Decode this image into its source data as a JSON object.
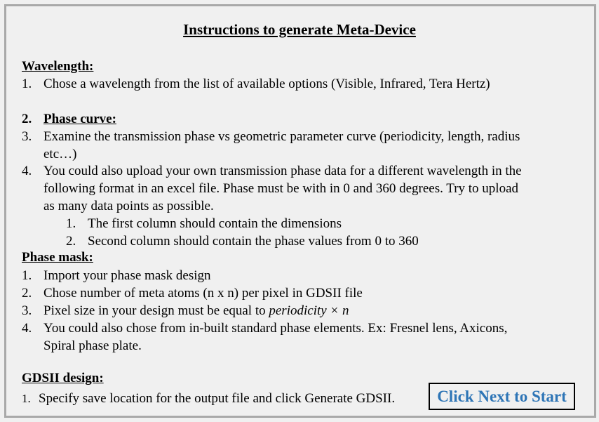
{
  "title": "Instructions to generate Meta-Device",
  "wavelength": {
    "heading": "Wavelength:",
    "items": [
      {
        "num": "1.",
        "text": "Chose a wavelength from the list of available options (Visible, Infrared, Tera Hertz)"
      }
    ]
  },
  "phase_curve": {
    "num": "2.",
    "heading": "Phase curve:",
    "items": [
      {
        "num": "3.",
        "lines": [
          "Examine the transmission phase vs geometric parameter curve (periodicity, length, radius",
          "etc…)"
        ]
      },
      {
        "num": "4.",
        "lines": [
          "You could also upload your own transmission phase data for a different wavelength  in the",
          "following format in an excel file. Phase must be with in 0 and 360 degrees. Try to upload",
          "as many data points as possible."
        ]
      }
    ],
    "subitems": [
      {
        "num": "1.",
        "text": "The first column should contain the dimensions"
      },
      {
        "num": "2.",
        "text": "Second column should contain the phase values from 0 to 360"
      }
    ]
  },
  "phase_mask": {
    "heading": "Phase mask:",
    "items": [
      {
        "num": "1.",
        "text": "Import your phase mask design"
      },
      {
        "num": "2.",
        "text": "Chose number of meta atoms (n x n) per pixel in GDSII file"
      },
      {
        "num": "3.",
        "text": "Pixel size in your design must be equal to",
        "math": "periodicity × n"
      },
      {
        "num": "4.",
        "lines": [
          "You could also chose from in-built standard phase elements. Ex: Fresnel lens, Axicons,",
          "Spiral phase plate."
        ]
      }
    ]
  },
  "gdsii": {
    "heading": "GDSII design:",
    "items": [
      {
        "num": "1.",
        "text": "Specify save location for the output file and click Generate GDSII."
      }
    ]
  },
  "next_button": {
    "label": "Click Next to Start"
  },
  "colors": {
    "button_text": "#2e75b6",
    "background": "#f0f0f0",
    "frame": "#a9a9a9"
  }
}
